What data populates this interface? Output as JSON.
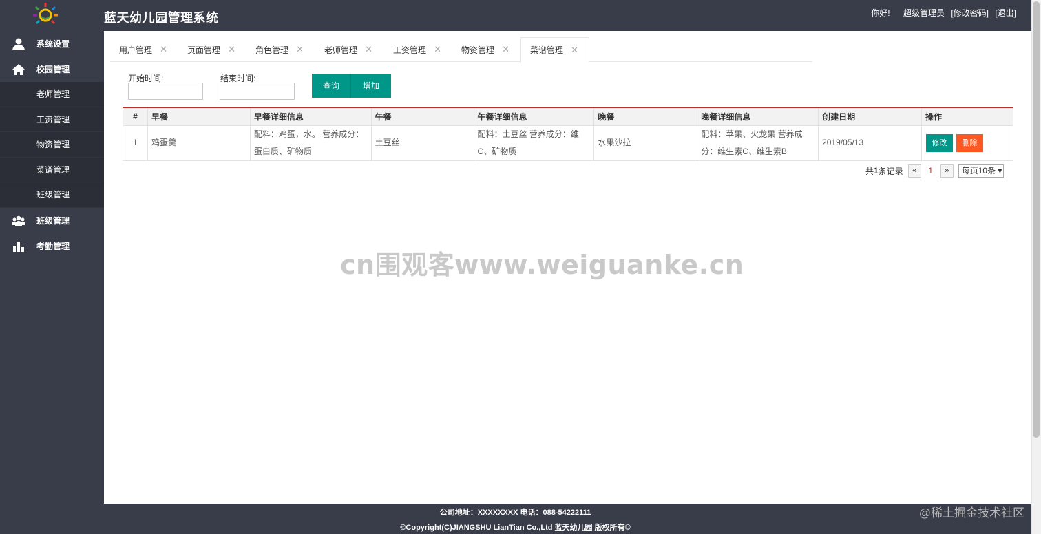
{
  "header": {
    "title": "蓝天幼儿园管理系统",
    "greeting": "你好!",
    "user": "超级管理员",
    "change_password": "[修改密码]",
    "logout": "[退出]"
  },
  "sidebar": {
    "items": [
      {
        "label": "系统设置",
        "icon": "user-icon"
      },
      {
        "label": "校园管理",
        "icon": "home-icon"
      },
      {
        "label": "班级管理",
        "icon": "group-icon"
      },
      {
        "label": "考勤管理",
        "icon": "bar-chart-icon"
      }
    ],
    "sub_items": [
      "老师管理",
      "工资管理",
      "物资管理",
      "菜谱管理",
      "班级管理"
    ]
  },
  "tabs": [
    {
      "label": "用户管理",
      "close": "✕"
    },
    {
      "label": "页面管理",
      "close": "✕"
    },
    {
      "label": "角色管理",
      "close": "✕"
    },
    {
      "label": "老师管理",
      "close": "✕"
    },
    {
      "label": "工资管理",
      "close": "✕"
    },
    {
      "label": "物资管理",
      "close": "✕"
    },
    {
      "label": "菜谱管理",
      "close": "✕"
    }
  ],
  "search": {
    "start_label": "开始时间:",
    "end_label": "结束时间:",
    "start_value": "",
    "end_value": "",
    "query_button": "查询",
    "add_button": "增加"
  },
  "table": {
    "headers": [
      "#",
      "早餐",
      "早餐详细信息",
      "午餐",
      "午餐详细信息",
      "晚餐",
      "晚餐详细信息",
      "创建日期",
      "操作"
    ],
    "rows": [
      {
        "index": "1",
        "breakfast": "鸡蛋羹",
        "breakfast_detail": "配料：鸡蛋，水。 营养成分：蛋白质、矿物质",
        "lunch": "土豆丝",
        "lunch_detail": "配料：土豆丝 营养成分：维C、矿物质",
        "dinner": "水果沙拉",
        "dinner_detail": "配料：苹果、火龙果 营养成分：维生素C、维生素B",
        "created": "2019/05/13",
        "edit": "修改",
        "delete": "删除"
      }
    ]
  },
  "pager": {
    "prefix": "共",
    "count": "1",
    "suffix": "条记录",
    "prev": "«",
    "current": "1",
    "next": "»",
    "page_size": "每页10条"
  },
  "watermark": "cn围观客www.weiguanke.cn",
  "footer": {
    "line1": "公司地址：XXXXXXXX 电话：088-54222111",
    "line2": "©Copyright(C)JIANGSHU LianTian Co.,Ltd 蓝天幼儿园 版权所有©"
  },
  "corner_mark": "@稀土掘金技术社区",
  "colors": {
    "dark": "#393d49",
    "sub_dark": "#2b2e37",
    "primary": "#009688",
    "danger": "#ff5722",
    "table_top": "#c12e2a"
  }
}
